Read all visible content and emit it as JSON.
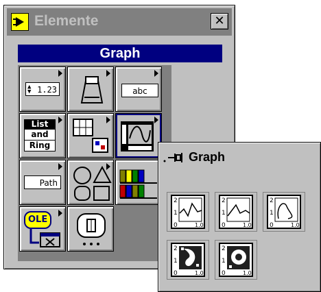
{
  "window": {
    "title": "Elemente",
    "close_label": "✕",
    "subpalette_header": "Graph"
  },
  "palette_items": [
    {
      "name": "numeric",
      "label": "1.23"
    },
    {
      "name": "boolean",
      "label": ""
    },
    {
      "name": "string",
      "label": "abc"
    },
    {
      "name": "list-and-ring",
      "label_lines": [
        "List",
        "and",
        "Ring"
      ]
    },
    {
      "name": "array-cluster",
      "label": ""
    },
    {
      "name": "graph",
      "label": ""
    },
    {
      "name": "path",
      "label": "Path"
    },
    {
      "name": "decorations",
      "label": ""
    },
    {
      "name": "refnum",
      "label": ""
    },
    {
      "name": "activex",
      "label": "OLE"
    },
    {
      "name": "dialog",
      "label": ""
    }
  ],
  "graph_palette": {
    "title": "Graph",
    "items": [
      "waveform-chart",
      "waveform-graph",
      "xy-graph",
      "intensity-chart",
      "intensity-graph"
    ]
  },
  "colors": {
    "window_bg": "#c0c0c0",
    "titlebar_bg": "#808080",
    "header_bg": "#000080"
  }
}
